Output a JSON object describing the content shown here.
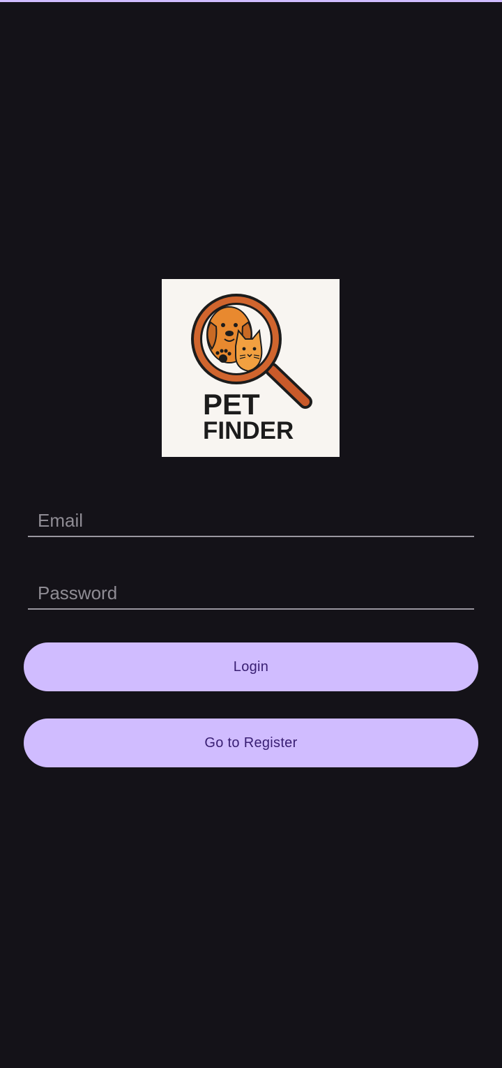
{
  "app": {
    "accent_color": "#d0bcff",
    "background_color": "#141218"
  },
  "logo": {
    "line1": "PET",
    "line2": "FINDER",
    "icon": "magnifier-with-dog-and-cat-icon"
  },
  "form": {
    "email_placeholder": "Email",
    "email_value": "",
    "password_placeholder": "Password",
    "password_value": ""
  },
  "actions": {
    "login_label": "Login",
    "register_label": "Go to Register"
  }
}
